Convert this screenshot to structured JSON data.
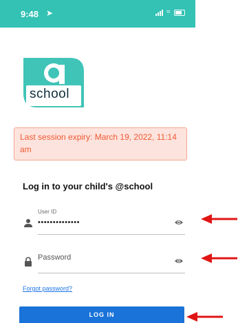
{
  "status_bar": {
    "time": "9:48",
    "location_icon": "navigation-arrow-icon",
    "background": "#33c2b4"
  },
  "logo": {
    "text": "school",
    "symbol": "@"
  },
  "alert": {
    "text": "Last session expiry: March 19, 2022, 11:14 am",
    "text_color": "#ef5a33",
    "background": "#fde3dd"
  },
  "page_title": "Log in to your child's @school",
  "user_id": {
    "label": "User ID",
    "value": "••••••••••••••",
    "icon": "person-icon"
  },
  "password": {
    "placeholder": "Password",
    "icon": "lock-icon"
  },
  "forgot_password": "Forgot password?",
  "login_button": {
    "label": "LOG IN",
    "color": "#1a73d8"
  },
  "annotations": {
    "arrow_color": "#e01515"
  }
}
